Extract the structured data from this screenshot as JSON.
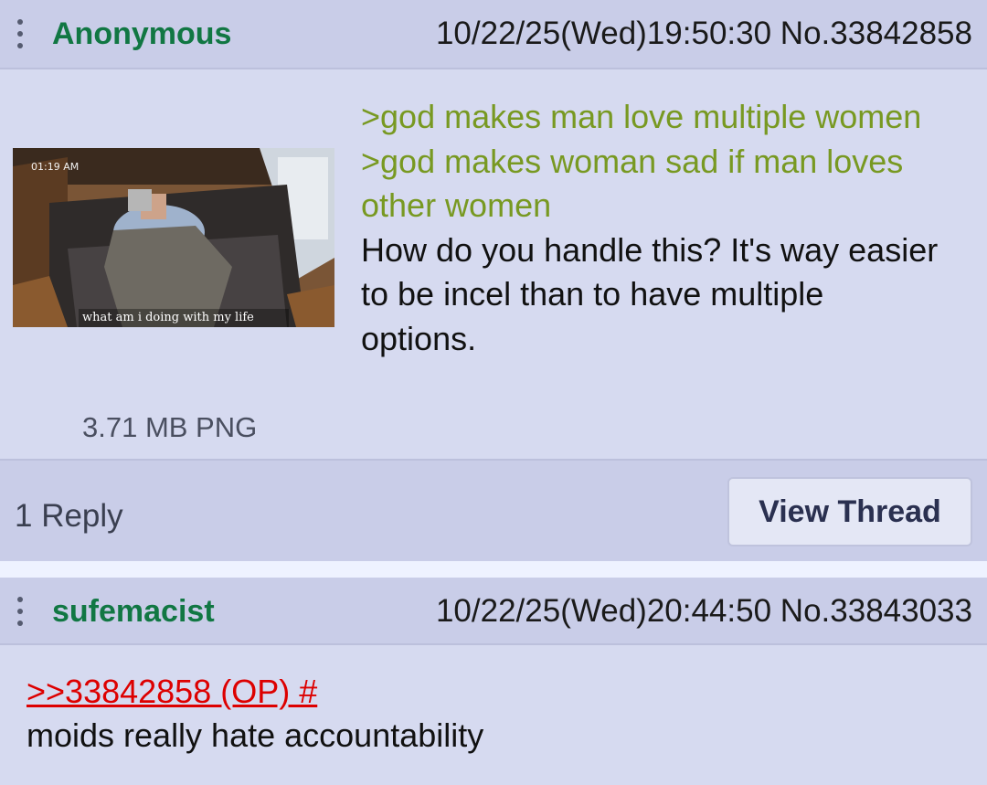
{
  "posts": [
    {
      "name": "Anonymous",
      "datetime": "10/22/25(Wed)19:50:30 No.33842858",
      "image": {
        "overlay_time": "01:19 AM",
        "overlay_caption": "what am i doing with my life",
        "filesize": "3.71 MB PNG"
      },
      "lines": [
        {
          "type": "greentext",
          "text": ">god makes man love multiple women"
        },
        {
          "type": "greentext",
          "text": ">god makes woman sad if man loves other women"
        },
        {
          "type": "plain",
          "text": "How do you handle this? It's way easier to be incel than to have multiple options."
        }
      ],
      "reply_count": "1 Reply",
      "view_thread_label": "View Thread"
    },
    {
      "name": "sufemacist",
      "datetime": "10/22/25(Wed)20:44:50 No.33843033",
      "quote_link": ">>33842858 (OP) #",
      "text": "moids really hate accountability"
    }
  ],
  "colors": {
    "name": "#117743",
    "greentext": "#789922",
    "quote_link": "#dd0000",
    "post_bg": "#d6daf0",
    "header_bg": "#c9cde8"
  },
  "icons": {
    "menu": "more-vertical-icon"
  }
}
